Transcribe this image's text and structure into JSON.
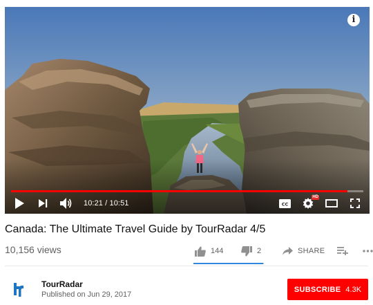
{
  "player": {
    "current_time": "10:21",
    "duration": "10:51",
    "time_display": "10:21 / 10:51",
    "progress_fraction": 0.954,
    "hd_badge": "HD"
  },
  "video": {
    "title": "Canada: The Ultimate Travel Guide by TourRadar 4/5",
    "views": "10,156 views",
    "like_count": "144",
    "dislike_count": "2",
    "share_label": "SHARE",
    "like_fraction": 0.986
  },
  "channel": {
    "name": "TourRadar",
    "published": "Published on Jun 29, 2017",
    "subscribe_label": "SUBSCRIBE",
    "subscriber_count": "4.3K"
  },
  "colors": {
    "accent": "#ff0000",
    "sentiment_bar": "#2f86dc",
    "channel_logo": "#1d75c4"
  },
  "icons": [
    "info-icon",
    "play-icon",
    "next-icon",
    "volume-icon",
    "captions-icon",
    "settings-icon",
    "theater-mode-icon",
    "fullscreen-icon",
    "thumbs-up-icon",
    "thumbs-down-icon",
    "share-icon",
    "add-to-playlist-icon",
    "more-icon"
  ]
}
